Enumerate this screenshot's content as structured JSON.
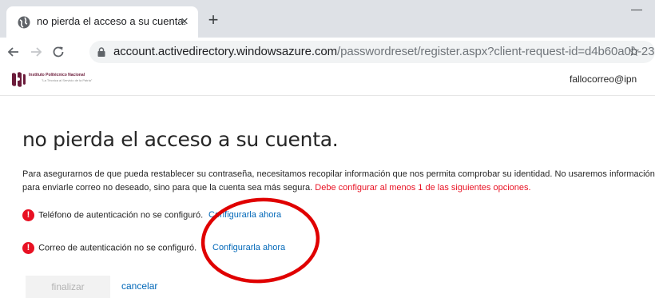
{
  "browser": {
    "tab_title": "no pierda el acceso a su cuenta.",
    "tab_close": "×",
    "new_tab": "+",
    "minimize": "—",
    "url_domain": "account.activedirectory.windowsazure.com",
    "url_path": "/passwordreset/register.aspx?client-request-id=d4b60a0b-23...",
    "star": "☆"
  },
  "header": {
    "org_name": "Instituto Politécnico Nacional",
    "org_tagline": "\"La Técnica al Servicio de la Patria\"",
    "user_email": "fallocorreo@ipn"
  },
  "main": {
    "title": "no pierda el acceso a su cuenta.",
    "intro_text": "Para asegurarnos de que pueda restablecer su contraseña, necesitamos recopilar información que nos permita comprobar su identidad. No usaremos información para enviarle correo no deseado, sino para que la cuenta sea más segura. ",
    "intro_warning": "Debe configurar al menos 1 de las siguientes opciones.",
    "options": [
      {
        "label": "Teléfono de autenticación no se configuró.",
        "link": "Configurarla ahora"
      },
      {
        "label": "Correo de autenticación no se configuró.",
        "link": "Configurarla ahora"
      }
    ],
    "finish_label": "finalizar",
    "cancel_label": "cancelar"
  },
  "colors": {
    "error": "#e81123",
    "link": "#0067b8",
    "annotation": "#e00000"
  }
}
